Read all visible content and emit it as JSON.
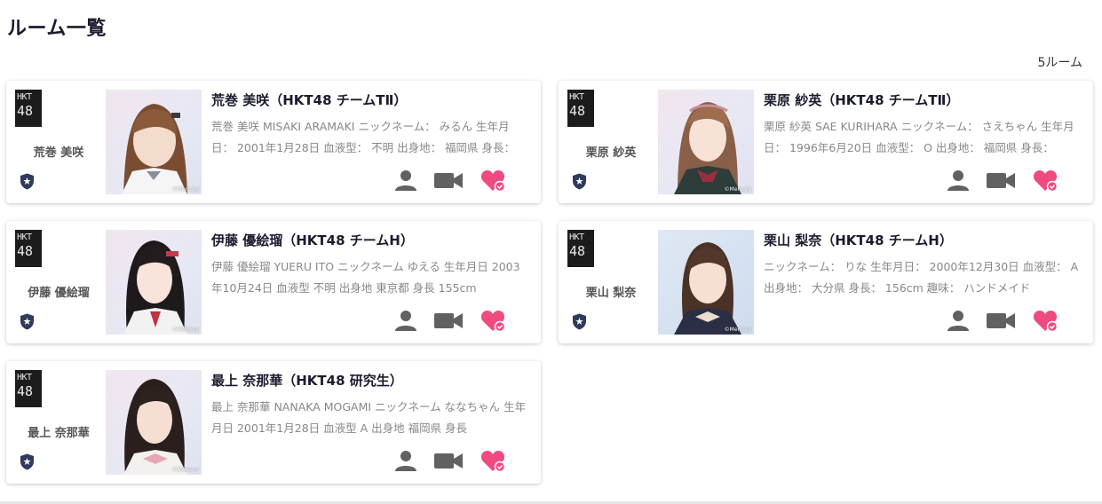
{
  "page": {
    "title": "ルーム一覧",
    "count_label": "5ルーム"
  },
  "colors": {
    "heart": "#ef4b7f",
    "icon_gray": "#616161",
    "badge": "#2f3a5c"
  },
  "rooms": [
    {
      "logo_top": "HKT",
      "logo_bottom": "48",
      "short_name": "荒巻 美咲",
      "title": "荒巻 美咲（HKT48 チームTⅡ）",
      "description": "荒巻 美咲 MISAKI ARAMAKI ニックネーム： みるん 生年月日： 2001年1月28日 血液型： 不明 出身地： 福岡県 身長：",
      "photo_credit": "©Mercury"
    },
    {
      "logo_top": "HKT",
      "logo_bottom": "48",
      "short_name": "栗原 紗英",
      "title": "栗原 紗英（HKT48 チームTⅡ）",
      "description": "栗原 紗英 SAE KURIHARA ニックネーム： さえちゃん 生年月日： 1996年6月20日 血液型： O 出身地： 福岡県 身長：",
      "photo_credit": "©Mercury"
    },
    {
      "logo_top": "HKT",
      "logo_bottom": "48",
      "short_name": "伊藤 優絵瑠",
      "title": "伊藤 優絵瑠（HKT48 チームH）",
      "description": "伊藤 優絵瑠 YUERU ITO ニックネーム ゆえる 生年月日 2003年10月24日 血液型 不明 出身地 東京都 身長 155cm",
      "photo_credit": "©Mercury"
    },
    {
      "logo_top": "HKT",
      "logo_bottom": "48",
      "short_name": "栗山 梨奈",
      "title": "栗山 梨奈（HKT48 チームH）",
      "description": "ニックネーム： りな 生年月日： 2000年12月30日 血液型： A 出身地： 大分県 身長： 156cm 趣味： ハンドメイド",
      "photo_credit": "©Mercury"
    },
    {
      "logo_top": "HKT",
      "logo_bottom": "48",
      "short_name": "最上 奈那華",
      "title": "最上 奈那華（HKT48 研究生）",
      "description": "最上 奈那華 NANAKA MOGAMI ニックネーム ななちゃん 生年月日 2001年1月28日 血液型 A 出身地 福岡県 身長",
      "photo_credit": "©Mercury"
    }
  ],
  "icons": {
    "profile": "person-icon",
    "live": "video-camera-icon",
    "follow": "heart-check-icon",
    "badge": "shield-star-icon"
  }
}
